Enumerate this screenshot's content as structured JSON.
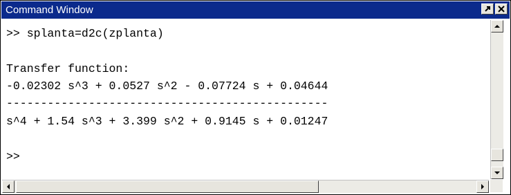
{
  "window": {
    "title": "Command Window"
  },
  "buttons": {
    "undock_icon": "undock-arrow-icon",
    "close_icon": "close-x-icon"
  },
  "console": {
    "lines": [
      ">> splanta=d2c(zplanta)",
      "",
      "Transfer function:",
      "-0.02302 s^3 + 0.0527 s^2 - 0.07724 s + 0.04644",
      "-----------------------------------------------",
      "s^4 + 1.54 s^3 + 3.399 s^2 + 0.9145 s + 0.01247",
      "",
      ">>"
    ]
  },
  "colors": {
    "titlebar": "#0b2a8c",
    "title_text": "#ffffff",
    "chrome": "#e7e5de"
  }
}
